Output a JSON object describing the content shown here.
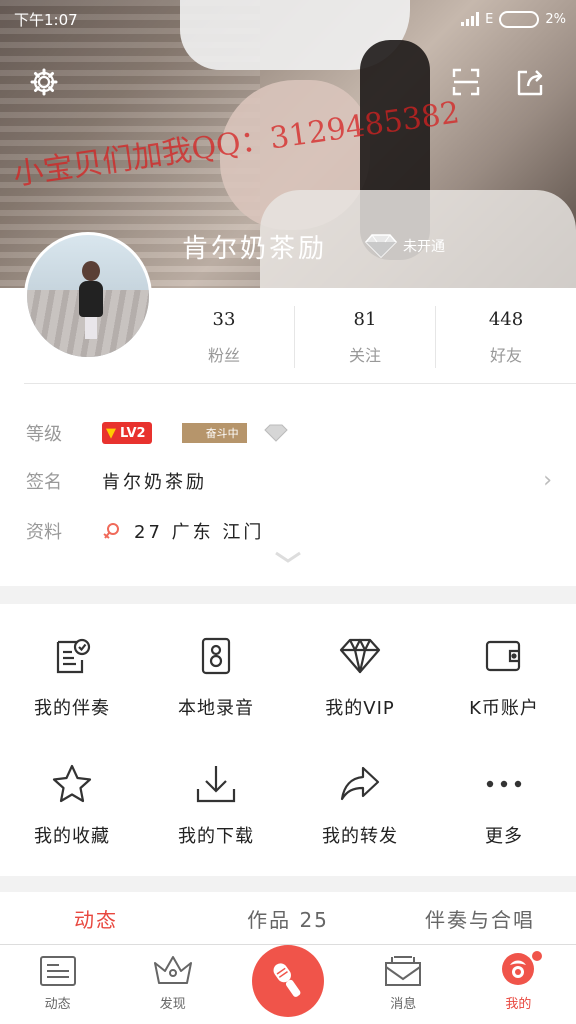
{
  "status_bar": {
    "time": "下午1:07",
    "network": "E",
    "battery": "2%"
  },
  "header": {
    "watermark": "小宝贝们加我QQ：3129485382",
    "username": "肯尔奶茶励",
    "vip_status": "未开通"
  },
  "stats": [
    {
      "value": "33",
      "label": "粉丝"
    },
    {
      "value": "81",
      "label": "关注"
    },
    {
      "value": "448",
      "label": "好友"
    }
  ],
  "profile": {
    "level_label": "等级",
    "level_badge": "LV2",
    "rank_badge": "奋斗中",
    "signature_label": "签名",
    "signature": "肯尔奶茶励",
    "info_label": "资料",
    "info": "27 广东 江门"
  },
  "menu": [
    {
      "label": "我的伴奏",
      "icon": "accompaniment-icon"
    },
    {
      "label": "本地录音",
      "icon": "local-recording-icon"
    },
    {
      "label": "我的VIP",
      "icon": "vip-diamond-icon"
    },
    {
      "label": "K币账户",
      "icon": "wallet-icon"
    },
    {
      "label": "我的收藏",
      "icon": "star-icon"
    },
    {
      "label": "我的下载",
      "icon": "download-icon"
    },
    {
      "label": "我的转发",
      "icon": "forward-icon"
    },
    {
      "label": "更多",
      "icon": "more-icon"
    }
  ],
  "tabs": [
    {
      "label": "动态"
    },
    {
      "label": "作品 25"
    },
    {
      "label": "伴奏与合唱"
    }
  ],
  "bottom_nav": [
    {
      "label": "动态"
    },
    {
      "label": "发现"
    },
    {
      "label": "消息"
    },
    {
      "label": "我的"
    }
  ],
  "colors": {
    "accent": "#e8483f",
    "level_badge": "#e8322e",
    "rank_badge": "#b6956b"
  }
}
